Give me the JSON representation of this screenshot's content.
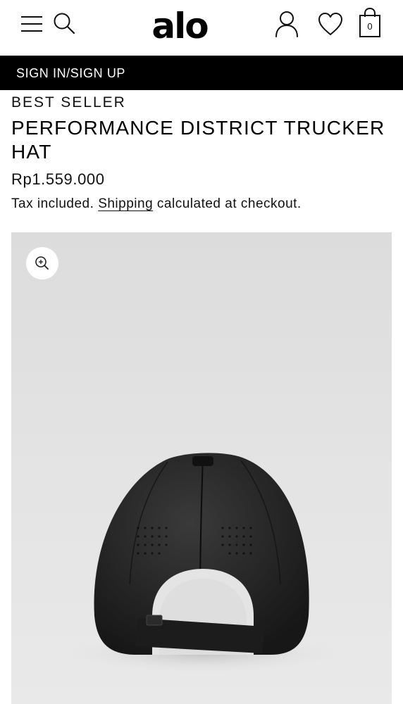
{
  "header": {
    "logo_text": "alo",
    "bag_count": "0",
    "icons": [
      "menu-icon",
      "search-icon",
      "user-icon",
      "heart-icon",
      "shopping-bag-icon"
    ]
  },
  "banner": {
    "signin_label": "SIGN IN/SIGN UP",
    "background": "#000000",
    "text_color": "#ffffff"
  },
  "product": {
    "badge": "BEST SELLER",
    "title": "PERFORMANCE DISTRICT TRUCKER HAT",
    "price": "Rp1.559.000",
    "tax_prefix": "Tax included.",
    "shipping_link": "Shipping",
    "tax_suffix": "calculated at checkout."
  },
  "media": {
    "zoom_icon": "zoom-in-icon",
    "image": "black-trucker-hat-back-view"
  }
}
